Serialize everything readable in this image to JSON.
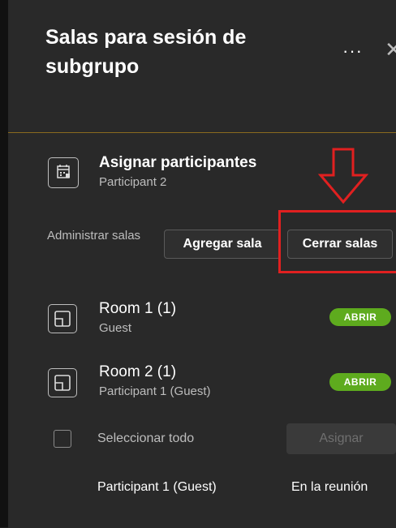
{
  "header": {
    "title": "Salas para sesión de subgrupo",
    "more_icon": "more-horizontal-icon",
    "close_icon": "close-icon"
  },
  "assign": {
    "title": "Asignar participantes",
    "subtitle": "Participant 2",
    "icon": "calendar-grid-icon"
  },
  "manage": {
    "label": "Administrar salas",
    "add_room_label": "Agregar sala",
    "close_rooms_label": "Cerrar salas"
  },
  "rooms": [
    {
      "name": "Room 1 (1)",
      "subtitle": "Guest",
      "badge": "ABRIR",
      "icon": "room-icon"
    },
    {
      "name": "Room 2 (1)",
      "subtitle": "Participant 1 (Guest)",
      "badge": "ABRIR",
      "icon": "room-icon"
    }
  ],
  "selection": {
    "select_all_label": "Seleccionar todo",
    "assign_label": "Asignar"
  },
  "participants": [
    {
      "name": "Participant 1 (Guest)",
      "status": "En la reunión"
    }
  ],
  "colors": {
    "accent_green": "#5eab1e",
    "highlight_red": "#e02020",
    "divider_gold": "#8a6a1f"
  }
}
